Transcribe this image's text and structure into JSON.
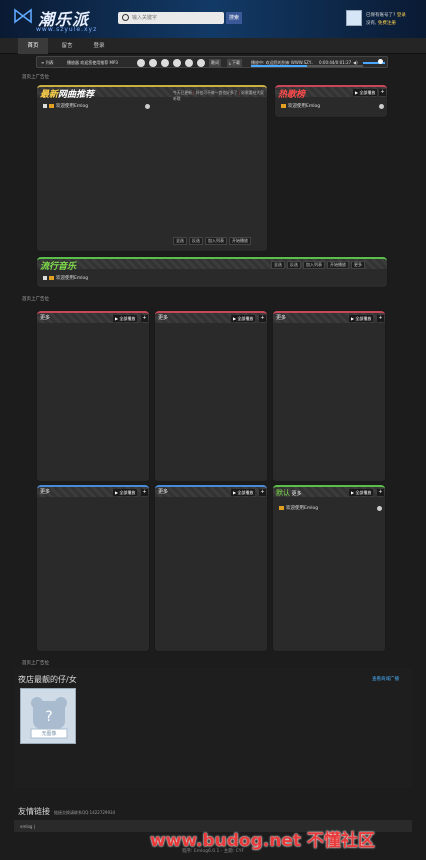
{
  "header": {
    "logo_text": "潮乐派",
    "logo_url": "www.szyule.xyz",
    "search_placeholder": "输入关键字",
    "search_button": "搜索",
    "user_line1_prefix": "已保有账号了?",
    "user_line1_link": "登录",
    "user_line2_prefix": "没有,",
    "user_line2_link": "免费注册"
  },
  "nav": {
    "items": [
      "首页",
      "留言",
      "登录"
    ]
  },
  "player": {
    "list_label": "列表",
    "song_label": "播放器 欢迎您使用推荐 MP3",
    "lyric_label": "歌词",
    "download_label": "下载",
    "now_playing": "播放中: 欢迎您的到来 WWW.SZY..",
    "time": "0:00:44/0:01:27",
    "progress": 0.5,
    "volume": 0.75
  },
  "sections": {
    "ad1": "首页上广告位",
    "ad2": "首页上广告位",
    "ad3": "首页上广告位"
  },
  "recommend": {
    "title_y": "最新",
    "title_w": "网曲推荐",
    "meta1": "今天已更新",
    "meta2": "好歌要给大家听哦",
    "meta3": "好也可不做一首也好多了",
    "row": "欢迎使用Emlog",
    "btn_all": "全选",
    "btn_rev": "反选",
    "btn_add": "加入列表",
    "btn_play": "开始播放"
  },
  "hot": {
    "title": "热歌榜",
    "play_all": "全部播放",
    "row": "欢迎使用Emlog"
  },
  "popular": {
    "title_g": "流行",
    "title_w": "音乐",
    "btn_all": "全选",
    "btn_rev": "反选",
    "btn_add": "加入列表",
    "btn_play": "开始播放",
    "btn_more": "更多",
    "row": "欢迎使用Emlog"
  },
  "grid": [
    {
      "label": "更多",
      "play_all": "全部播放",
      "row": ""
    },
    {
      "label": "更多",
      "play_all": "全部播放",
      "row": ""
    },
    {
      "label": "更多",
      "play_all": "全部播放",
      "row": ""
    },
    {
      "label": "更多",
      "play_all": "全部播放",
      "row": ""
    },
    {
      "label": "更多",
      "play_all": "全部播放",
      "row": ""
    },
    {
      "label": "默认",
      "label2": "更多",
      "play_all": "全部播放",
      "row": "欢迎使用Emlog"
    }
  ],
  "bottom": {
    "title": "夜店最靓的仔/女",
    "link": "查看商城广播",
    "thumb_caption": "无图像"
  },
  "friends": {
    "title": "友情链接",
    "sub": "链接交换请联系QQ:1422729934",
    "box": "emlog |"
  },
  "footer": "程序: Emlog6.0.1 · 主题: CYF",
  "watermark": "www.budog.net 不懂社区"
}
